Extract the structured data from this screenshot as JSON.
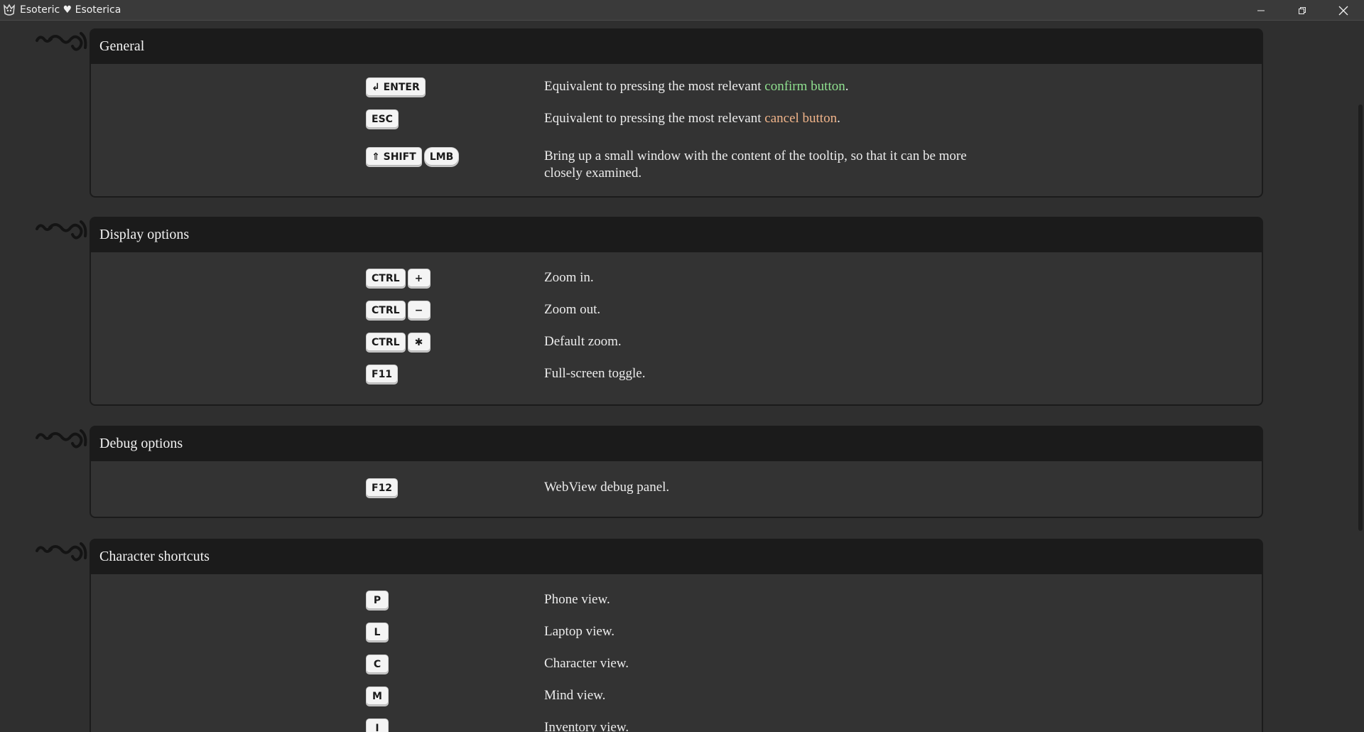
{
  "window": {
    "title": "Esoteric ♥ Esoterica",
    "minimize_icon": "minimize-icon",
    "restore_icon": "restore-icon",
    "close_icon": "close-icon"
  },
  "sections": [
    {
      "title": "General",
      "rows": [
        {
          "keys": [
            "↲ ENTER"
          ],
          "desc_before": "Equivalent to pressing the most relevant ",
          "desc_highlight": "confirm button",
          "desc_after": ".",
          "highlight_color": "#8fe08f"
        },
        {
          "keys": [
            "ESC"
          ],
          "desc_before": "Equivalent to pressing the most relevant ",
          "desc_highlight": "cancel button",
          "desc_after": ".",
          "highlight_color": "#f0b48a"
        },
        {
          "keys": [
            "⇑ SHIFT",
            "LMB"
          ],
          "desc": "Bring up a small window with the content of the tooltip, so that it can be more closely examined."
        }
      ]
    },
    {
      "title": "Display options",
      "rows": [
        {
          "keys": [
            "CTRL",
            "+"
          ],
          "desc": "Zoom in."
        },
        {
          "keys": [
            "CTRL",
            "−"
          ],
          "desc": "Zoom out."
        },
        {
          "keys": [
            "CTRL",
            "✱"
          ],
          "desc": "Default zoom."
        },
        {
          "keys": [
            "F11"
          ],
          "desc": "Full-screen toggle."
        }
      ]
    },
    {
      "title": "Debug options",
      "rows": [
        {
          "keys": [
            "F12"
          ],
          "desc": "WebView debug panel."
        }
      ]
    },
    {
      "title": "Character shortcuts",
      "rows": [
        {
          "keys": [
            "P"
          ],
          "desc": "Phone view."
        },
        {
          "keys": [
            "L"
          ],
          "desc": "Laptop view."
        },
        {
          "keys": [
            "C"
          ],
          "desc": "Character view."
        },
        {
          "keys": [
            "M"
          ],
          "desc": "Mind view."
        },
        {
          "keys": [
            "I"
          ],
          "desc": "Inventory view."
        }
      ]
    }
  ]
}
